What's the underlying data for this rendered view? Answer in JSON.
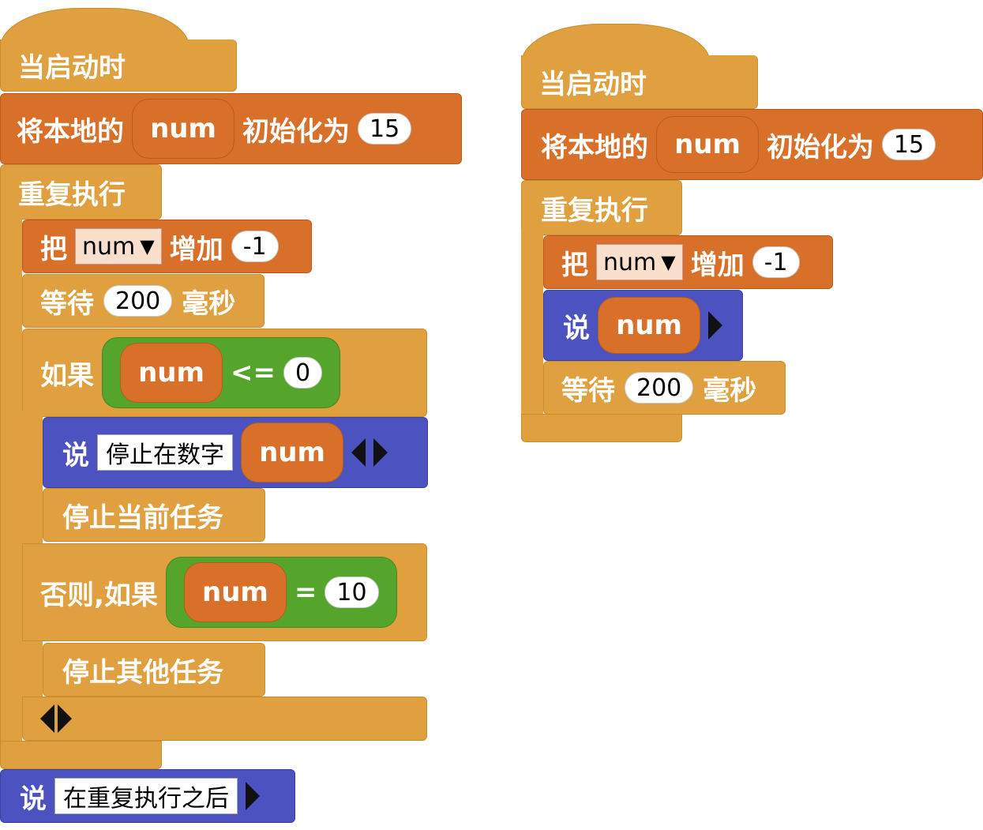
{
  "scriptA": {
    "hat_label": "当启动时",
    "init": {
      "prefix": "将本地的",
      "var": "num",
      "mid": "初始化为",
      "value": "15"
    },
    "repeat_label": "重复执行",
    "change": {
      "prefix": "把",
      "var": "num",
      "mid": "增加",
      "value": "-1"
    },
    "wait": {
      "prefix": "等待",
      "value": "200",
      "suffix": "毫秒"
    },
    "if": {
      "label": "如果",
      "var": "num",
      "op": "<=",
      "value": "0"
    },
    "say1": {
      "label": "说",
      "text": "停止在数字",
      "var": "num"
    },
    "stop_current": "停止当前任务",
    "elseif": {
      "label": "否则,如果",
      "var": "num",
      "op": "=",
      "value": "10"
    },
    "stop_other": "停止其他任务",
    "say_after": {
      "label": "说",
      "text": "在重复执行之后"
    }
  },
  "scriptB": {
    "hat_label": "当启动时",
    "init": {
      "prefix": "将本地的",
      "var": "num",
      "mid": "初始化为",
      "value": "15"
    },
    "repeat_label": "重复执行",
    "change": {
      "prefix": "把",
      "var": "num",
      "mid": "增加",
      "value": "-1"
    },
    "say": {
      "label": "说",
      "var": "num"
    },
    "wait": {
      "prefix": "等待",
      "value": "200",
      "suffix": "毫秒"
    }
  },
  "colors": {
    "control": "#e0a040",
    "variables": "#d9702a",
    "looks": "#4c53c1",
    "operators": "#55a52c"
  },
  "icons": [
    "dropdown-arrow-icon",
    "expand-right-icon",
    "collapse-left-icon"
  ]
}
